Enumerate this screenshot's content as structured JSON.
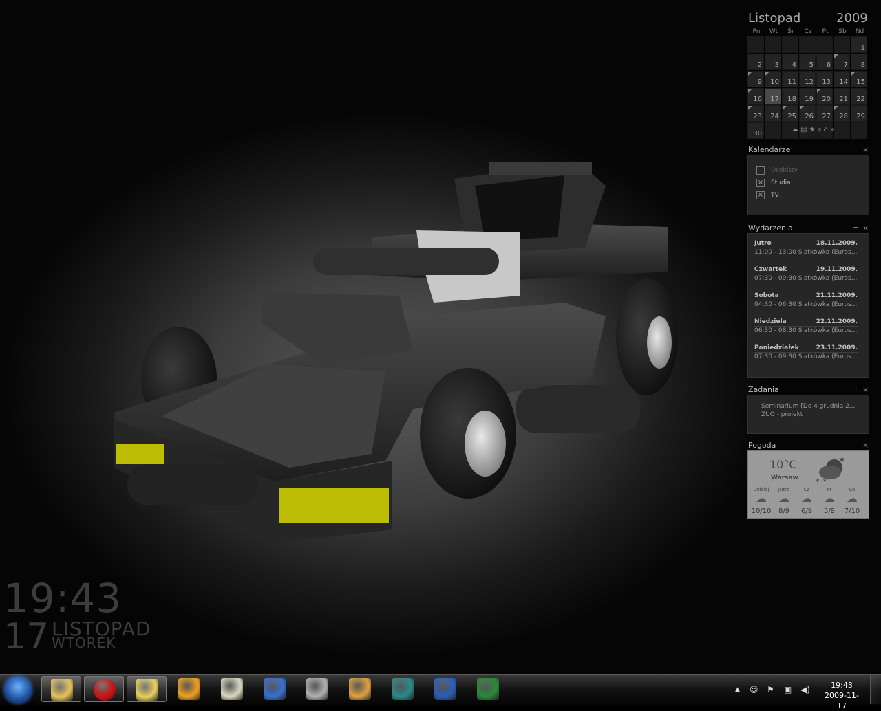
{
  "desktop": {
    "big_clock": {
      "time": "19:43",
      "day": "17",
      "month": "LISTOPAD",
      "weekday": "WTOREK"
    }
  },
  "calendar": {
    "month": "Listopad",
    "year": "2009",
    "weekdays": [
      "Pn",
      "Wt",
      "Śr",
      "Cz",
      "Pt",
      "Sb",
      "Nd"
    ],
    "days": [
      "1",
      "2",
      "3",
      "4",
      "5",
      "6",
      "7",
      "8",
      "9",
      "10",
      "11",
      "12",
      "13",
      "14",
      "15",
      "16",
      "17",
      "18",
      "19",
      "20",
      "21",
      "22",
      "23",
      "24",
      "25",
      "26",
      "27",
      "28",
      "29",
      "30"
    ],
    "today": "17",
    "toolbar_icons": [
      "cloud-icon",
      "list-icon",
      "star-icon",
      "previous-icon",
      "home-icon",
      "next-icon"
    ]
  },
  "calendars": {
    "title": "Kalendarze",
    "items": [
      {
        "label": "Osobisty",
        "checked": false
      },
      {
        "label": "Studia",
        "checked": true
      },
      {
        "label": "TV",
        "checked": true
      }
    ]
  },
  "events": {
    "title": "Wydarzenia",
    "items": [
      {
        "day": "Jutro",
        "date": "18.11.2009.",
        "desc": "11:00 - 13:00 Siatkówka (Euros..."
      },
      {
        "day": "Czwartek",
        "date": "19.11.2009.",
        "desc": "07:30 - 09:30 Siatkówka (Euros..."
      },
      {
        "day": "Sobota",
        "date": "21.11.2009.",
        "desc": "04:30 - 06:30 Siatkówka (Euros..."
      },
      {
        "day": "Niedziela",
        "date": "22.11.2009.",
        "desc": "06:30 - 08:30 Siatkówka (Euros..."
      },
      {
        "day": "Poniedziałek",
        "date": "23.11.2009.",
        "desc": "07:30 - 09:30 Siatkówka (Euros..."
      }
    ]
  },
  "tasks": {
    "title": "Zadania",
    "items": [
      "Seminarium [Do 4 grudnia 2...",
      "ZUO - projekt"
    ]
  },
  "weather": {
    "title": "Pogoda",
    "temp": "10°C",
    "city": "Warsaw",
    "forecast": [
      {
        "day": "Dzisiaj",
        "temps": "10/10"
      },
      {
        "day": "Jutro",
        "temps": "8/9"
      },
      {
        "day": "Cz",
        "temps": "6/9"
      },
      {
        "day": "Pt",
        "temps": "5/8"
      },
      {
        "day": "Sb",
        "temps": "7/10"
      }
    ]
  },
  "controls": {
    "add": "+",
    "close": "×"
  },
  "taskbar": {
    "apps": [
      "start-orb",
      "explorer-icon",
      "opera-icon",
      "idea-bulb-icon",
      "winamp-icon",
      "notepad-icon",
      "paint-icon",
      "movie-maker-icon",
      "pro-app-icon",
      "spiral-app-icon",
      "word-icon",
      "excel-icon"
    ],
    "clock_time": "19:43",
    "clock_date": "2009-11-17"
  }
}
